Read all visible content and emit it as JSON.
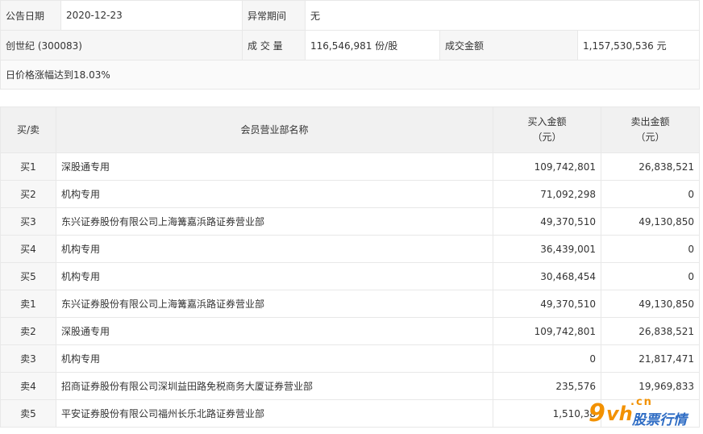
{
  "info": {
    "date_label": "公告日期",
    "date_value": "2020-12-23",
    "period_label": "异常期间",
    "period_value": "无",
    "stock_value": "创世纪 (300083)",
    "volume_label": "成 交 量",
    "volume_value": "116,546,981 份/股",
    "amount_label": "成交金额",
    "amount_value": "1,157,530,536 元",
    "reason": "日价格涨幅达到18.03%"
  },
  "table": {
    "headers": {
      "side": "买/卖",
      "name": "会员营业部名称",
      "buy_line1": "买入金额",
      "buy_line2": "（元）",
      "sell_line1": "卖出金额",
      "sell_line2": "（元）"
    },
    "rows": [
      {
        "side": "买1",
        "name": "深股通专用",
        "buy": "109,742,801",
        "sell": "26,838,521"
      },
      {
        "side": "买2",
        "name": "机构专用",
        "buy": "71,092,298",
        "sell": "0"
      },
      {
        "side": "买3",
        "name": "东兴证券股份有限公司上海篝嘉浜路证券营业部",
        "buy": "49,370,510",
        "sell": "49,130,850"
      },
      {
        "side": "买4",
        "name": "机构专用",
        "buy": "36,439,001",
        "sell": "0"
      },
      {
        "side": "买5",
        "name": "机构专用",
        "buy": "30,468,454",
        "sell": "0"
      },
      {
        "side": "卖1",
        "name": "东兴证券股份有限公司上海篝嘉浜路证券营业部",
        "buy": "49,370,510",
        "sell": "49,130,850"
      },
      {
        "side": "卖2",
        "name": "深股通专用",
        "buy": "109,742,801",
        "sell": "26,838,521"
      },
      {
        "side": "卖3",
        "name": "机构专用",
        "buy": "0",
        "sell": "21,817,471"
      },
      {
        "side": "卖4",
        "name": "招商证券股份有限公司深圳益田路免税商务大厦证券营业部",
        "buy": "235,576",
        "sell": "19,969,833"
      },
      {
        "side": "卖5",
        "name": "平安证券股份有限公司福州长乐北路证券营业部",
        "buy": "1,510,38",
        "sell": ""
      }
    ]
  },
  "watermark": {
    "mark_9": "9",
    "mark_vh": "vh",
    "mark_cn": ".cn",
    "mark_text": "股票行情"
  }
}
